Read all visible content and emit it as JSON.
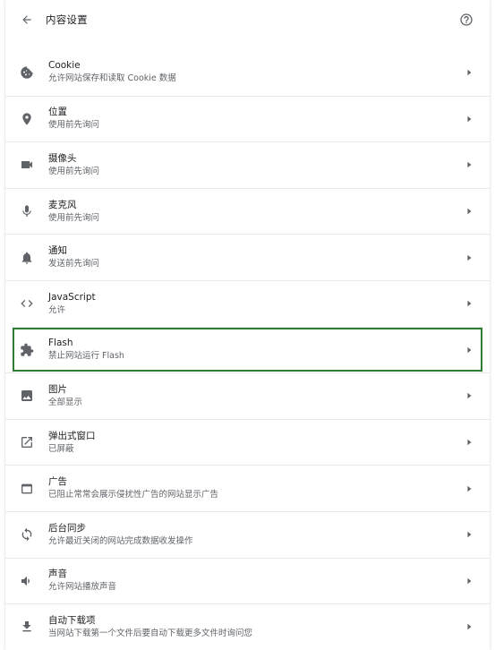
{
  "header": {
    "title": "内容设置",
    "back_icon": "arrow-back-icon",
    "help_icon": "help-icon"
  },
  "colors": {
    "highlight_border": "#2e7d32",
    "icon": "#5f6368",
    "divider": "#e8eaed"
  },
  "rows": [
    {
      "id": "cookie",
      "icon": "cookie-icon",
      "label": "Cookie",
      "desc": "允许网站保存和读取 Cookie 数据"
    },
    {
      "id": "location",
      "icon": "location-icon",
      "label": "位置",
      "desc": "使用前先询问"
    },
    {
      "id": "camera",
      "icon": "camera-icon",
      "label": "摄像头",
      "desc": "使用前先询问"
    },
    {
      "id": "microphone",
      "icon": "microphone-icon",
      "label": "麦克风",
      "desc": "使用前先询问"
    },
    {
      "id": "notifications",
      "icon": "bell-icon",
      "label": "通知",
      "desc": "发送前先询问"
    },
    {
      "id": "javascript",
      "icon": "code-icon",
      "label": "JavaScript",
      "desc": "允许"
    },
    {
      "id": "flash",
      "icon": "puzzle-icon",
      "label": "Flash",
      "desc": "禁止网站运行 Flash",
      "highlighted": true
    },
    {
      "id": "images",
      "icon": "image-icon",
      "label": "图片",
      "desc": "全部显示"
    },
    {
      "id": "popups",
      "icon": "open-in-new-icon",
      "label": "弹出式窗口",
      "desc": "已屏蔽"
    },
    {
      "id": "ads",
      "icon": "window-icon",
      "label": "广告",
      "desc": "已阻止常常会展示侵扰性广告的网站显示广告"
    },
    {
      "id": "background-sync",
      "icon": "sync-icon",
      "label": "后台同步",
      "desc": "允许最近关闭的网站完成数据收发操作"
    },
    {
      "id": "sound",
      "icon": "volume-icon",
      "label": "声音",
      "desc": "允许网站播放声音"
    },
    {
      "id": "downloads",
      "icon": "download-icon",
      "label": "自动下载项",
      "desc": "当网站下载第一个文件后要自动下载更多文件时询问您"
    }
  ]
}
